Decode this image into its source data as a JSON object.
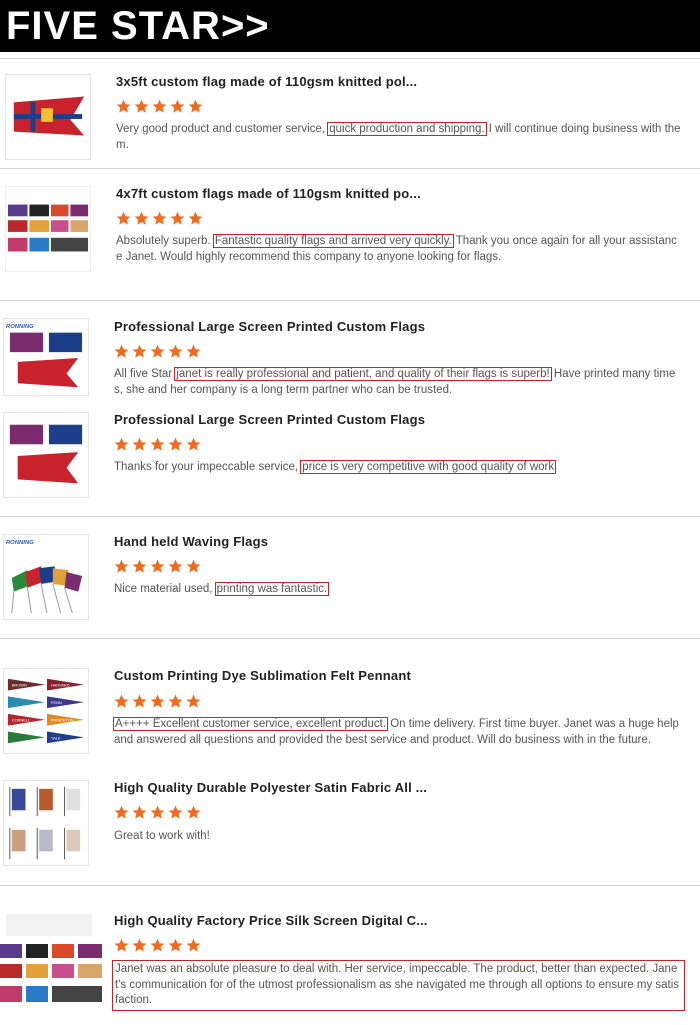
{
  "banner": {
    "title": "FIVE STAR>>"
  },
  "colors": {
    "star": "#ef6b1f",
    "highlight_box": "#c2262b"
  },
  "reviews": [
    {
      "title": "3x5ft custom flag made of 110gsm knitted pol...",
      "rating": 5,
      "text_before": "Very good product and customer service, ",
      "text_highlight": "quick production and shipping.",
      "text_after": " I will continue doing business with them."
    },
    {
      "title": "4x7ft custom flags made of 110gsm knitted po...",
      "rating": 5,
      "text_before": "Absolutely superb. ",
      "text_highlight": "Fantastic quality flags and arrived very quickly.",
      "text_after": " Thank you once again for all your assistance Janet. Would highly recommend this company to anyone looking for flags."
    },
    {
      "title": "Professional Large Screen Printed Custom Flags",
      "rating": 5,
      "text_before": "All five Star ",
      "text_highlight": "janet is really professional and patient, and quality of their flags is superb!",
      "text_after": " Have printed many times, she and her company is a long term partner who can be trusted."
    },
    {
      "title": "Professional Large Screen Printed Custom Flags",
      "rating": 5,
      "text_before": "Thanks for your impeccable service, ",
      "text_highlight": "price is very competitive with good quality of work",
      "text_after": ""
    },
    {
      "title": "Hand held Waving Flags",
      "rating": 5,
      "text_before": "Nice material used, ",
      "text_highlight": "printing was fantastic.",
      "text_after": ""
    },
    {
      "title": "Custom Printing Dye Sublimation Felt Pennant",
      "rating": 5,
      "text_before": "",
      "text_highlight": "A++++ Excellent customer service, excellent product.",
      "text_after": " On time delivery. First time buyer. Janet was a huge help and answered all questions and provided the best service and product. Will do business with in the future."
    },
    {
      "title": "High Quality Durable Polyester Satin Fabric All ...",
      "rating": 5,
      "text_before": "Great to work with!",
      "text_highlight": "",
      "text_after": ""
    },
    {
      "title": "High Quality Factory Price Silk Screen Digital C...",
      "rating": 5,
      "text_before": "",
      "text_highlight": "Janet was an absolute pleasure to deal with. Her service, impeccable. The product, better than expected. Janet's communication for of the utmost professionalism as she navigated me through all options to ensure my satisfaction.",
      "text_after": ""
    }
  ],
  "thumb_brand": "RONNING",
  "pennant_labels": [
    "BROWN",
    "HARVARD",
    "PENN",
    "CORNELL",
    "PRINCETON",
    "YALE"
  ]
}
